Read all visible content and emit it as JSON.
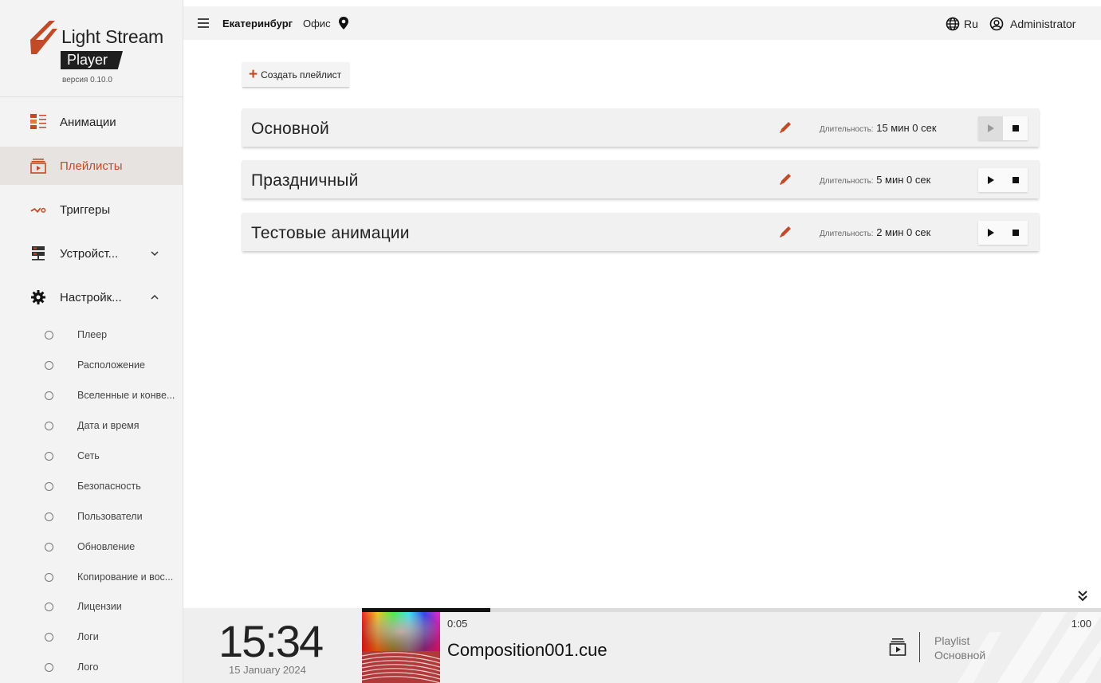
{
  "brand": {
    "title": "Light Stream",
    "subtitle": "Player",
    "version": "версия 0.10.0",
    "accent_color": "#c24b27"
  },
  "sidebar": {
    "items": [
      {
        "label": "Анимации",
        "icon": "animations-icon",
        "active": false
      },
      {
        "label": "Плейлисты",
        "icon": "playlist-icon",
        "active": true
      },
      {
        "label": "Триггеры",
        "icon": "triggers-icon",
        "active": false
      },
      {
        "label": "Устройст...",
        "icon": "devices-icon",
        "active": false,
        "expandable": true,
        "expanded": false
      },
      {
        "label": "Настройк...",
        "icon": "gear-icon",
        "active": false,
        "expandable": true,
        "expanded": true
      }
    ],
    "settings_subitems": [
      "Плеер",
      "Расположение",
      "Вселенные и конве...",
      "Дата и время",
      "Сеть",
      "Безопасность",
      "Пользователи",
      "Обновление",
      "Копирование и вос...",
      "Лицензии",
      "Логи",
      "Лого"
    ]
  },
  "topbar": {
    "city": "Екатеринбург",
    "place": "Офис",
    "language": "Ru",
    "user": "Administrator"
  },
  "main": {
    "create_button": "Создать плейлист",
    "duration_label": "Длительность:",
    "playlists": [
      {
        "name": "Основной",
        "duration": "15 мин 0 сек",
        "playing": true
      },
      {
        "name": "Праздничный",
        "duration": "5 мин 0 сек",
        "playing": false
      },
      {
        "name": "Тестовые анимации",
        "duration": "2 мин 0 сек",
        "playing": false
      }
    ]
  },
  "player": {
    "time": "15:34",
    "date": "15 January 2024",
    "current_time": "0:05",
    "total_time": "1:00",
    "progress": 0.174,
    "composition": "Composition001.cue",
    "playlist_caption": "Playlist",
    "playlist_name": "Основной"
  }
}
